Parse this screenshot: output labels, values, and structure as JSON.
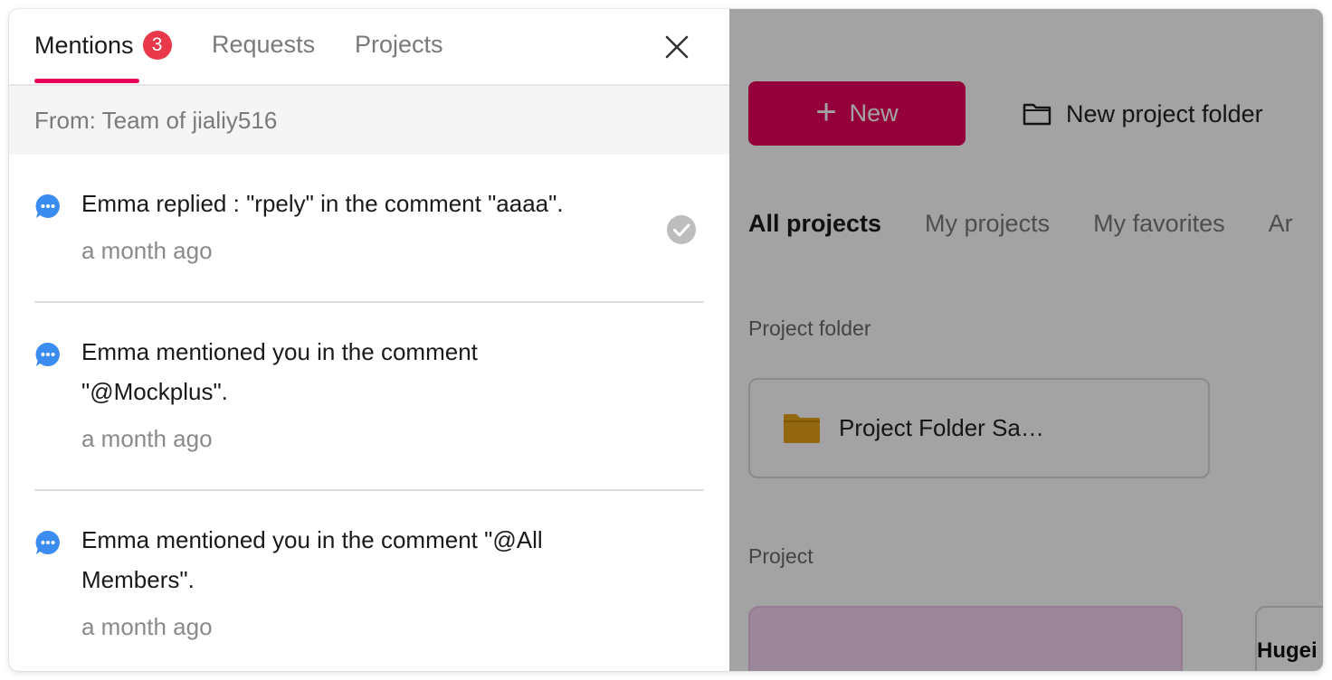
{
  "panel": {
    "tabs": [
      {
        "label": "Mentions",
        "badge": "3",
        "active": true
      },
      {
        "label": "Requests",
        "active": false
      },
      {
        "label": "Projects",
        "active": false
      }
    ],
    "from_label": "From: Team of jialiy516",
    "notifications": [
      {
        "text": "Emma replied : \"rpely\" in the comment \"aaaa\".",
        "time": "a month ago",
        "read": true
      },
      {
        "text": "Emma mentioned you in the comment \"@Mockplus\".",
        "time": "a month ago",
        "read": false
      },
      {
        "text": "Emma mentioned you in the comment \"@All Members\".",
        "time": "a month ago",
        "read": false
      }
    ]
  },
  "app": {
    "new_button_label": "New",
    "new_folder_label": "New project folder",
    "project_tabs": [
      "All projects",
      "My projects",
      "My favorites",
      "Ar"
    ],
    "section_folder_label": "Project folder",
    "folder_card_name": "Project Folder Sa…",
    "section_project_label": "Project",
    "project_card_2_name": "Hugei"
  },
  "colors": {
    "accent": "#e6005c",
    "badge": "#e8384a",
    "comment_icon": "#3b8cf0",
    "folder": "#e5a21a",
    "check": "#bdbdbd"
  },
  "icons": {
    "close": "close-icon",
    "comment": "comment-bubble-icon",
    "check": "check-circle-icon",
    "folder": "folder-icon",
    "plus": "plus-icon"
  }
}
